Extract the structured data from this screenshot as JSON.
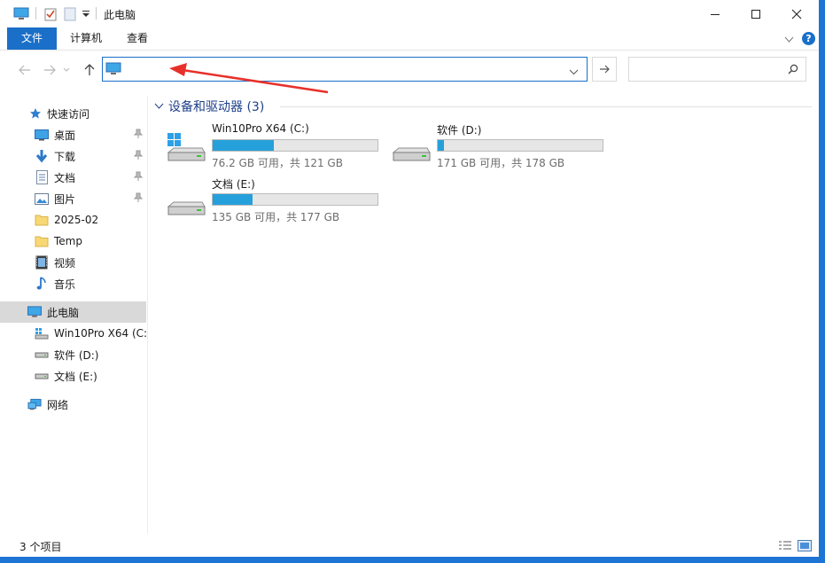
{
  "window": {
    "title": "此电脑",
    "controls": [
      "minimize-icon",
      "maximize-icon",
      "close-icon"
    ]
  },
  "ribbon": {
    "tabs": [
      {
        "label": "文件",
        "active": true
      },
      {
        "label": "计算机"
      },
      {
        "label": "查看"
      }
    ]
  },
  "address": {
    "value": "",
    "icon": "this-pc-icon"
  },
  "search": {
    "placeholder": ""
  },
  "sidebar": {
    "quick_access": "快速访问",
    "pinned": [
      {
        "label": "桌面",
        "icon": "desktop-icon",
        "pinned": true
      },
      {
        "label": "下载",
        "icon": "download-icon",
        "pinned": true
      },
      {
        "label": "文档",
        "icon": "documents-icon",
        "pinned": true
      },
      {
        "label": "图片",
        "icon": "pictures-icon",
        "pinned": true
      }
    ],
    "recent": [
      {
        "label": "2025-02",
        "icon": "folder-icon"
      },
      {
        "label": "Temp",
        "icon": "folder-icon"
      },
      {
        "label": "视频",
        "icon": "videos-icon"
      },
      {
        "label": "音乐",
        "icon": "music-icon"
      }
    ],
    "this_pc": "此电脑",
    "drives": [
      {
        "label": "Win10Pro X64 (C:)",
        "icon": "windows-drive-icon"
      },
      {
        "label": "软件 (D:)",
        "icon": "drive-icon"
      },
      {
        "label": "文档 (E:)",
        "icon": "drive-icon"
      }
    ],
    "network": "网络"
  },
  "main": {
    "group_title": "设备和驱动器 (3)",
    "drives": [
      {
        "name": "Win10Pro X64 (C:)",
        "free": "76.2 GB 可用，共 121 GB",
        "used_fraction": 0.37,
        "icon": "windows-drive-icon"
      },
      {
        "name": "软件 (D:)",
        "free": "171 GB 可用，共 178 GB",
        "used_fraction": 0.04,
        "icon": "drive-icon"
      },
      {
        "name": "文档 (E:)",
        "free": "135 GB 可用，共 177 GB",
        "used_fraction": 0.24,
        "icon": "drive-icon"
      }
    ]
  },
  "status": {
    "count": "3 个项目"
  },
  "colors": {
    "accent": "#1a6fc9",
    "bar_fill": "#26a0da",
    "annotation": "#e8302a"
  }
}
